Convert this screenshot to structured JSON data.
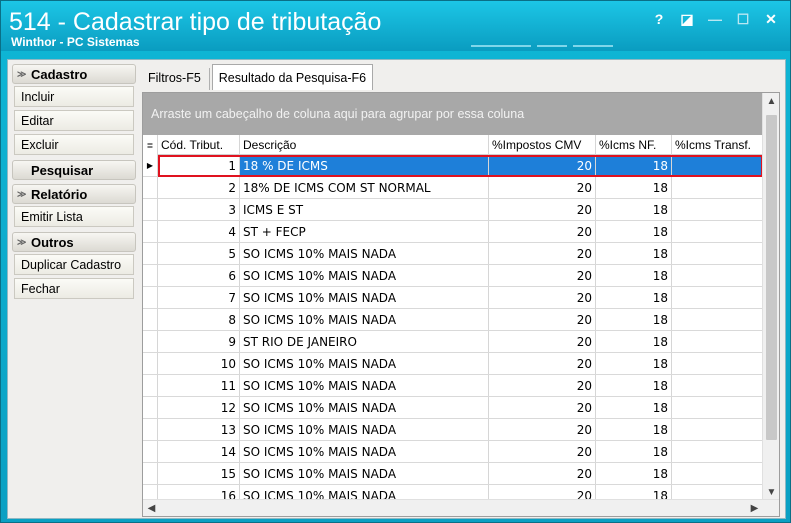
{
  "window": {
    "title": "514 - Cadastrar tipo de tributação",
    "subtitle": "Winthor - PC Sistemas",
    "buttons": {
      "help": "?",
      "restore_small": "◪",
      "minimize": "—",
      "maximize": "☐",
      "close": "✕"
    }
  },
  "sidebar": {
    "groups": [
      {
        "header": "Cadastro",
        "chevron": "≫",
        "items": [
          "Incluir",
          "Editar",
          "Excluir"
        ]
      },
      {
        "header": "Pesquisar",
        "chevron": "",
        "items": []
      },
      {
        "header": "Relatório",
        "chevron": "≫",
        "items": [
          "Emitir Lista"
        ]
      },
      {
        "header": "Outros",
        "chevron": "≫",
        "items": [
          "Duplicar Cadastro",
          "Fechar"
        ]
      }
    ]
  },
  "tabs": [
    {
      "label": "Filtros-F5",
      "active": false
    },
    {
      "label": "Resultado da Pesquisa-F6",
      "active": true
    }
  ],
  "grid": {
    "group_hint": "Arraste um cabeçalho de coluna aqui para agrupar por essa coluna",
    "columns": [
      "≣",
      "Cód. Tribut.",
      "Descrição",
      "%Impostos CMV",
      "%Icms NF.",
      "%Icms Transf."
    ],
    "rows": [
      [
        "1",
        "18 % DE ICMS",
        "20",
        "18",
        ""
      ],
      [
        "2",
        "18% DE ICMS COM ST NORMAL",
        "20",
        "18",
        ""
      ],
      [
        "3",
        "ICMS E ST",
        "20",
        "18",
        ""
      ],
      [
        "4",
        "ST + FECP",
        "20",
        "18",
        ""
      ],
      [
        "5",
        "SO ICMS 10% MAIS NADA",
        "20",
        "18",
        ""
      ],
      [
        "6",
        "SO ICMS 10% MAIS NADA",
        "20",
        "18",
        ""
      ],
      [
        "7",
        "SO ICMS 10% MAIS NADA",
        "20",
        "18",
        ""
      ],
      [
        "8",
        "SO ICMS 10% MAIS NADA",
        "20",
        "18",
        ""
      ],
      [
        "9",
        "ST RIO DE JANEIRO",
        "20",
        "18",
        ""
      ],
      [
        "10",
        "SO ICMS 10% MAIS NADA",
        "20",
        "18",
        ""
      ],
      [
        "11",
        "SO ICMS 10% MAIS NADA",
        "20",
        "18",
        ""
      ],
      [
        "12",
        "SO ICMS 10% MAIS NADA",
        "20",
        "18",
        ""
      ],
      [
        "13",
        "SO ICMS 10% MAIS NADA",
        "20",
        "18",
        ""
      ],
      [
        "14",
        "SO ICMS 10% MAIS NADA",
        "20",
        "18",
        ""
      ],
      [
        "15",
        "SO ICMS 10% MAIS NADA",
        "20",
        "18",
        ""
      ],
      [
        "16",
        "SO ICMS 10% MAIS NADA",
        "20",
        "18",
        ""
      ]
    ],
    "selected_row": 0,
    "indicator": "▶"
  },
  "colors": {
    "selection": "#1e7fd9",
    "highlight_border": "#e0121f",
    "title_bg": "#0aa0c3"
  }
}
